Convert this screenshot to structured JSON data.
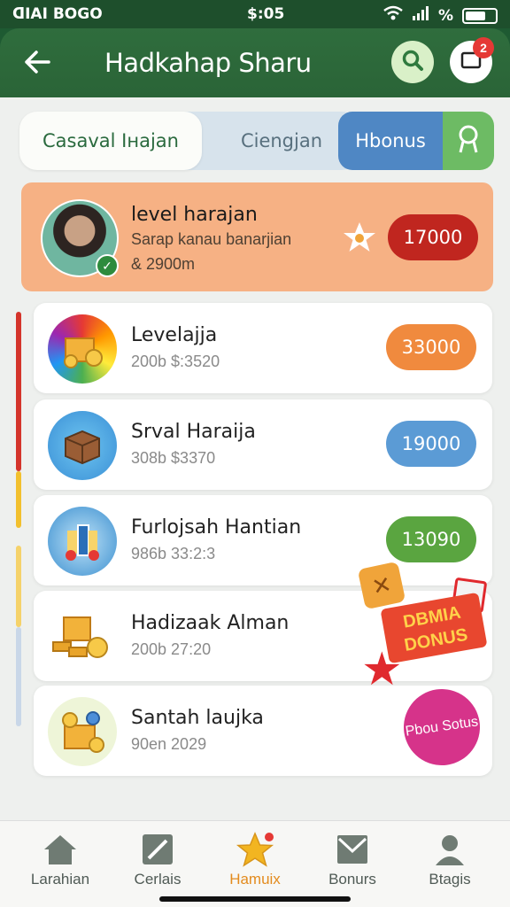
{
  "status_bar": {
    "carrier": "ᗡIAI BOGO",
    "time": "$:05",
    "battery_label": "%"
  },
  "app_bar": {
    "title": "Hadkahap Sharu",
    "notification_count": "2"
  },
  "tabs": [
    {
      "label": "Casaval Iнajan"
    },
    {
      "label": "Ciengjan"
    },
    {
      "label": "Hbonus"
    },
    {
      "label": ""
    }
  ],
  "featured": {
    "title": "level harajan",
    "subtitle": "Sarap kanau banarjian",
    "meta": "& 2900m",
    "value": "17000"
  },
  "items": [
    {
      "title": "Levelajja",
      "meta": "200b  $:3520",
      "value": "33000",
      "color": "#f08a3e"
    },
    {
      "title": "Srval Haraija",
      "meta": "308b  $3370",
      "value": "19000",
      "color": "#5b9bd5"
    },
    {
      "title": "Furlojsah Hantian",
      "meta": "986b  33:2:3",
      "value": "13090",
      "color": "#5aa540"
    },
    {
      "title": "Hadizaak Alman",
      "meta": "200b  27:20",
      "value": "",
      "color": ""
    },
    {
      "title": "Santah laujka",
      "meta": "90en  2029",
      "value": "",
      "color": ""
    }
  ],
  "promo": {
    "banner_text": "DBMIA DONUS",
    "circle_text": "Pbou Sotus"
  },
  "bottom_nav": [
    {
      "label": "Larahian",
      "icon": "home-icon"
    },
    {
      "label": "Cerlais",
      "icon": "edit-icon"
    },
    {
      "label": "Hamuix",
      "icon": "star-icon"
    },
    {
      "label": "Bonurs",
      "icon": "mail-icon"
    },
    {
      "label": "Btagis",
      "icon": "profile-icon"
    }
  ],
  "colors": {
    "header": "#2a6437",
    "featured_bg": "#f6b184",
    "accent_red": "#c0261f",
    "active_tab": "#e38b1e"
  }
}
